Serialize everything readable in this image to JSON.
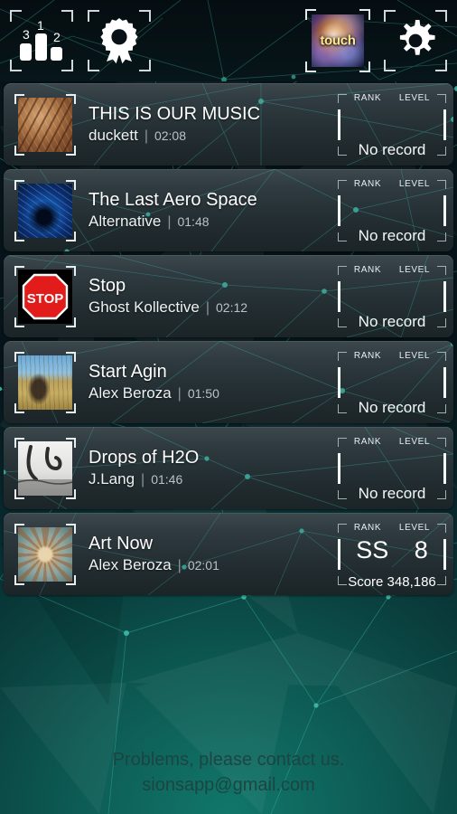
{
  "topbar": {
    "buttons": [
      {
        "name": "ranking-chart-icon",
        "label": "Ranking",
        "bars": [
          "3",
          "1",
          "2"
        ]
      },
      {
        "name": "award-ribbon-icon",
        "label": "Awards"
      },
      {
        "name": "touch-thumbnail",
        "label": "touch"
      },
      {
        "name": "settings-gear-icon",
        "label": "Settings"
      }
    ]
  },
  "list": {
    "headers": {
      "rank": "RANK",
      "level": "LEVEL"
    },
    "no_record": "No record",
    "items": [
      {
        "title": "THIS IS OUR MUSIC",
        "artist": "duckett",
        "separator": "|",
        "duration": "02:08",
        "rank": "",
        "level": "",
        "status": "No record",
        "score": ""
      },
      {
        "title": "The Last Aero Space",
        "artist": "Alternative",
        "separator": "|",
        "duration": "01:48",
        "rank": "",
        "level": "",
        "status": "No record",
        "score": ""
      },
      {
        "title": "Stop",
        "artist": "Ghost Kollective",
        "separator": "|",
        "duration": "02:12",
        "rank": "",
        "level": "",
        "status": "No record",
        "score": ""
      },
      {
        "title": "Start Agin",
        "artist": "Alex Beroza",
        "separator": "|",
        "duration": "01:50",
        "rank": "",
        "level": "",
        "status": "No record",
        "score": ""
      },
      {
        "title": "Drops of H2O",
        "artist": "J.Lang",
        "separator": "|",
        "duration": "01:46",
        "rank": "",
        "level": "",
        "status": "No record",
        "score": ""
      },
      {
        "title": "Art Now",
        "artist": "Alex Beroza",
        "separator": "|",
        "duration": "02:01",
        "rank": "SS",
        "level": "8",
        "status": "",
        "score": "Score 348,186"
      }
    ]
  },
  "footer": {
    "line1": "Problems, please contact us.",
    "line2": "sionsapp@gmail.com"
  },
  "colors": {
    "accent_teal": "#2aa398",
    "row_top": "#3c484c",
    "row_bottom": "#1b2427",
    "topbar_bg": "#061215",
    "text_primary": "#fdfdfd",
    "footer_text": "#1d4240",
    "touch_label": "#ffe98a"
  }
}
